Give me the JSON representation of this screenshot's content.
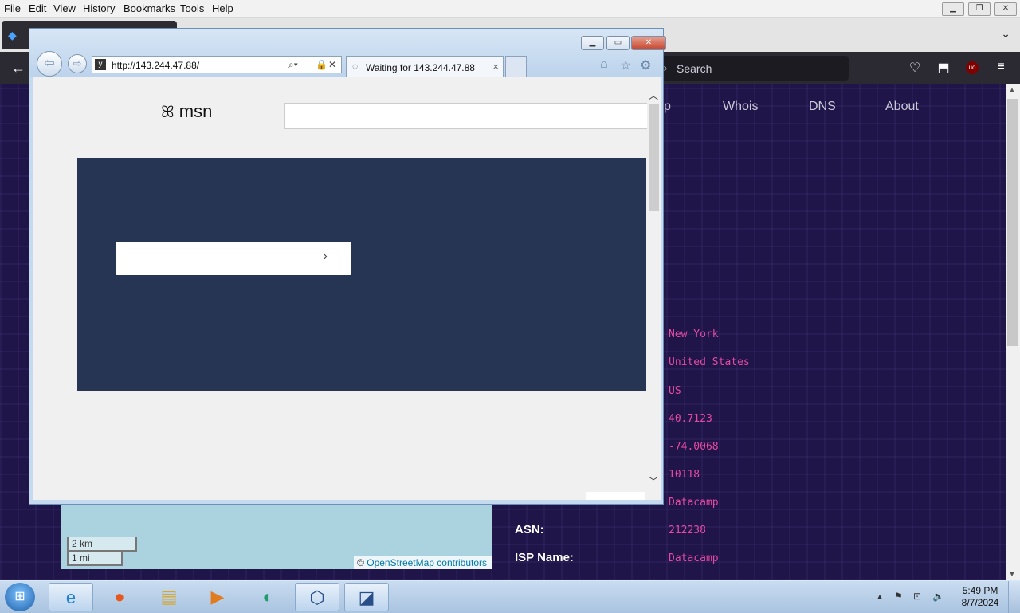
{
  "menubar": {
    "items": [
      "File",
      "Edit",
      "View",
      "History",
      "Bookmarks",
      "Tools",
      "Help"
    ]
  },
  "firefox": {
    "search_placeholder": "Search"
  },
  "site": {
    "nav": [
      "p",
      "Whois",
      "DNS",
      "About"
    ],
    "info_rows": [
      {
        "label": "",
        "value": "New York"
      },
      {
        "label": "",
        "value": "United States"
      },
      {
        "label": "",
        "value": "US"
      },
      {
        "label": "",
        "value": "40.7123"
      },
      {
        "label": "",
        "value": "-74.0068"
      },
      {
        "label": "",
        "value": "10118"
      },
      {
        "label": "",
        "value": "Datacamp"
      },
      {
        "label": "ASN:",
        "value": "212238"
      },
      {
        "label": "ISP Name:",
        "value": "Datacamp"
      }
    ],
    "map": {
      "scale_km": "2 km",
      "scale_mi": "1 mi",
      "attribution_prefix": "©",
      "attribution_link": "OpenStreetMap contributors"
    }
  },
  "ie": {
    "address": "http://143.244.47.88/",
    "tab_title": "Waiting for 143.244.47.88",
    "page": {
      "logo_text": "msn"
    }
  },
  "taskbar": {
    "time": "5:49 PM",
    "date": "8/7/2024"
  },
  "colors": {
    "page_bg": "#1f1548",
    "value_pink": "#e64aa3",
    "hero_navy": "#263553"
  }
}
